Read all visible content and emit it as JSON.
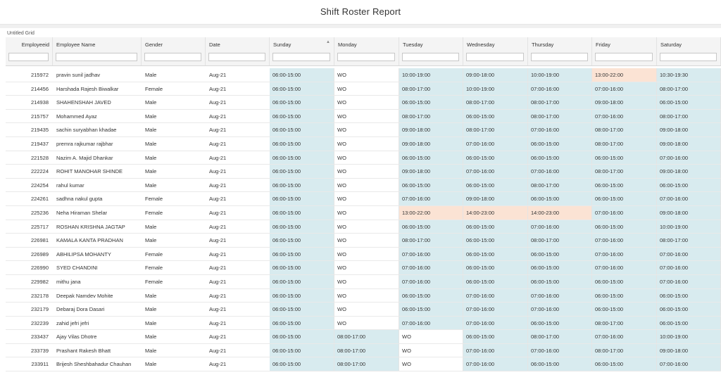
{
  "report_title": "Shift Roster Report",
  "grid_title": "Untitled Grid",
  "columns": [
    "Employeeid",
    "Employee Name",
    "Gender",
    "Date",
    "Sunday",
    "Monday",
    "Tuesday",
    "Wednesday",
    "Thursday",
    "Friday",
    "Saturday"
  ],
  "colors": {
    "blue_cell": "#d8ebef",
    "peach_cell": "#fbe3d4",
    "white_cell": "#ffffff",
    "header_bg": "#f4f4f4"
  },
  "rows": [
    {
      "id": "215972",
      "name": "pravin sunil jadhav",
      "gender": "Male",
      "date": "Aug-21",
      "days": [
        "06:00-15:00",
        "WO",
        "10:00-19:00",
        "09:00-18:00",
        "10:00-19:00",
        "13:00-22:00",
        "10:30-19:30"
      ],
      "tone": [
        "b",
        "w",
        "b",
        "b",
        "b",
        "p",
        "b"
      ]
    },
    {
      "id": "214456",
      "name": "Harshada Rajesh Biwalkar",
      "gender": "Female",
      "date": "Aug-21",
      "days": [
        "06:00-15:00",
        "WO",
        "08:00-17:00",
        "10:00-19:00",
        "07:00-16:00",
        "07:00-16:00",
        "08:00-17:00"
      ],
      "tone": [
        "b",
        "w",
        "b",
        "b",
        "b",
        "b",
        "b"
      ]
    },
    {
      "id": "214938",
      "name": "SHAHENSHAH JAVED",
      "gender": "Male",
      "date": "Aug-21",
      "days": [
        "06:00-15:00",
        "WO",
        "06:00-15:00",
        "08:00-17:00",
        "08:00-17:00",
        "09:00-18:00",
        "06:00-15:00"
      ],
      "tone": [
        "b",
        "w",
        "b",
        "b",
        "b",
        "b",
        "b"
      ]
    },
    {
      "id": "215757",
      "name": "Mohammed Ayaz",
      "gender": "Male",
      "date": "Aug-21",
      "days": [
        "06:00-15:00",
        "WO",
        "08:00-17:00",
        "06:00-15:00",
        "08:00-17:00",
        "07:00-16:00",
        "08:00-17:00"
      ],
      "tone": [
        "b",
        "w",
        "b",
        "b",
        "b",
        "b",
        "b"
      ]
    },
    {
      "id": "219435",
      "name": "sachin suryabhan khadae",
      "gender": "Male",
      "date": "Aug-21",
      "days": [
        "06:00-15:00",
        "WO",
        "09:00-18:00",
        "08:00-17:00",
        "07:00-16:00",
        "08:00-17:00",
        "09:00-18:00"
      ],
      "tone": [
        "b",
        "w",
        "b",
        "b",
        "b",
        "b",
        "b"
      ]
    },
    {
      "id": "219437",
      "name": "premra rajkumar rajbhar",
      "gender": "Male",
      "date": "Aug-21",
      "days": [
        "06:00-15:00",
        "WO",
        "09:00-18:00",
        "07:00-16:00",
        "06:00-15:00",
        "08:00-17:00",
        "09:00-18:00"
      ],
      "tone": [
        "b",
        "w",
        "b",
        "b",
        "b",
        "b",
        "b"
      ]
    },
    {
      "id": "221528",
      "name": "Nazim A. Majid Dhankar",
      "gender": "Male",
      "date": "Aug-21",
      "days": [
        "06:00-15:00",
        "WO",
        "06:00-15:00",
        "06:00-15:00",
        "06:00-15:00",
        "06:00-15:00",
        "07:00-16:00"
      ],
      "tone": [
        "b",
        "w",
        "b",
        "b",
        "b",
        "b",
        "b"
      ]
    },
    {
      "id": "222224",
      "name": "ROHIT MANOHAR SHINDE",
      "gender": "Male",
      "date": "Aug-21",
      "days": [
        "06:00-15:00",
        "WO",
        "09:00-18:00",
        "07:00-16:00",
        "07:00-16:00",
        "08:00-17:00",
        "09:00-18:00"
      ],
      "tone": [
        "b",
        "w",
        "b",
        "b",
        "b",
        "b",
        "b"
      ]
    },
    {
      "id": "224254",
      "name": "rahul kumar",
      "gender": "Male",
      "date": "Aug-21",
      "days": [
        "06:00-15:00",
        "WO",
        "06:00-15:00",
        "06:00-15:00",
        "08:00-17:00",
        "06:00-15:00",
        "06:00-15:00"
      ],
      "tone": [
        "b",
        "w",
        "b",
        "b",
        "b",
        "b",
        "b"
      ]
    },
    {
      "id": "224261",
      "name": "sadhna nakul gupta",
      "gender": "Female",
      "date": "Aug-21",
      "days": [
        "06:00-15:00",
        "WO",
        "07:00-16:00",
        "09:00-18:00",
        "06:00-15:00",
        "06:00-15:00",
        "07:00-16:00"
      ],
      "tone": [
        "b",
        "w",
        "b",
        "b",
        "b",
        "b",
        "b"
      ]
    },
    {
      "id": "225236",
      "name": "Neha Hiraman Shelar",
      "gender": "Female",
      "date": "Aug-21",
      "days": [
        "06:00-15:00",
        "WO",
        "13:00-22:00",
        "14:00-23:00",
        "14:00-23:00",
        "07:00-16:00",
        "09:00-18:00"
      ],
      "tone": [
        "b",
        "w",
        "p",
        "p",
        "p",
        "b",
        "b"
      ]
    },
    {
      "id": "225717",
      "name": "ROSHAN KRISHNA JAGTAP",
      "gender": "Male",
      "date": "Aug-21",
      "days": [
        "06:00-15:00",
        "WO",
        "06:00-15:00",
        "06:00-15:00",
        "07:00-16:00",
        "06:00-15:00",
        "10:00-19:00"
      ],
      "tone": [
        "b",
        "w",
        "b",
        "b",
        "b",
        "b",
        "b"
      ]
    },
    {
      "id": "226981",
      "name": "KAMALA KANTA PRADHAN",
      "gender": "Male",
      "date": "Aug-21",
      "days": [
        "06:00-15:00",
        "WO",
        "08:00-17:00",
        "06:00-15:00",
        "08:00-17:00",
        "07:00-16:00",
        "08:00-17:00"
      ],
      "tone": [
        "b",
        "w",
        "b",
        "b",
        "b",
        "b",
        "b"
      ]
    },
    {
      "id": "226989",
      "name": "ABHILIPSA MOHANTY",
      "gender": "Female",
      "date": "Aug-21",
      "days": [
        "06:00-15:00",
        "WO",
        "07:00-16:00",
        "06:00-15:00",
        "06:00-15:00",
        "07:00-16:00",
        "07:00-16:00"
      ],
      "tone": [
        "b",
        "w",
        "b",
        "b",
        "b",
        "b",
        "b"
      ]
    },
    {
      "id": "226990",
      "name": "SYED CHANDINI",
      "gender": "Female",
      "date": "Aug-21",
      "days": [
        "06:00-15:00",
        "WO",
        "07:00-16:00",
        "06:00-15:00",
        "06:00-15:00",
        "07:00-16:00",
        "07:00-16:00"
      ],
      "tone": [
        "b",
        "w",
        "b",
        "b",
        "b",
        "b",
        "b"
      ]
    },
    {
      "id": "229982",
      "name": "mithu jana",
      "gender": "Female",
      "date": "Aug-21",
      "days": [
        "06:00-15:00",
        "WO",
        "07:00-16:00",
        "06:00-15:00",
        "06:00-15:00",
        "06:00-15:00",
        "07:00-16:00"
      ],
      "tone": [
        "b",
        "w",
        "b",
        "b",
        "b",
        "b",
        "b"
      ]
    },
    {
      "id": "232178",
      "name": "Deepak Namdev Mohite",
      "gender": "Male",
      "date": "Aug-21",
      "days": [
        "06:00-15:00",
        "WO",
        "06:00-15:00",
        "07:00-16:00",
        "07:00-16:00",
        "06:00-15:00",
        "06:00-15:00"
      ],
      "tone": [
        "b",
        "w",
        "b",
        "b",
        "b",
        "b",
        "b"
      ]
    },
    {
      "id": "232179",
      "name": "Debaraj Dora Dasari",
      "gender": "Male",
      "date": "Aug-21",
      "days": [
        "06:00-15:00",
        "WO",
        "06:00-15:00",
        "07:00-16:00",
        "07:00-16:00",
        "06:00-15:00",
        "06:00-15:00"
      ],
      "tone": [
        "b",
        "w",
        "b",
        "b",
        "b",
        "b",
        "b"
      ]
    },
    {
      "id": "232239",
      "name": "zahid jefri jefri",
      "gender": "Male",
      "date": "Aug-21",
      "days": [
        "06:00-15:00",
        "WO",
        "07:00-16:00",
        "07:00-16:00",
        "06:00-15:00",
        "08:00-17:00",
        "06:00-15:00"
      ],
      "tone": [
        "b",
        "w",
        "b",
        "b",
        "b",
        "b",
        "b"
      ]
    },
    {
      "id": "233437",
      "name": "Ajay Vilas Dhotre",
      "gender": "Male",
      "date": "Aug-21",
      "days": [
        "06:00-15:00",
        "08:00-17:00",
        "WO",
        "06:00-15:00",
        "08:00-17:00",
        "07:00-16:00",
        "10:00-19:00"
      ],
      "tone": [
        "b",
        "b",
        "w",
        "b",
        "b",
        "b",
        "b"
      ]
    },
    {
      "id": "233739",
      "name": "Prashant Rakesh Bhatt",
      "gender": "Male",
      "date": "Aug-21",
      "days": [
        "06:00-15:00",
        "08:00-17:00",
        "WO",
        "07:00-16:00",
        "07:00-16:00",
        "08:00-17:00",
        "09:00-18:00"
      ],
      "tone": [
        "b",
        "b",
        "w",
        "b",
        "b",
        "b",
        "b"
      ]
    },
    {
      "id": "233911",
      "name": "Brijesh Sheshbahadur Chauhan",
      "gender": "Male",
      "date": "Aug-21",
      "days": [
        "06:00-15:00",
        "08:00-17:00",
        "WO",
        "07:00-16:00",
        "06:00-15:00",
        "06:00-15:00",
        "07:00-16:00"
      ],
      "tone": [
        "b",
        "b",
        "w",
        "b",
        "b",
        "b",
        "b"
      ]
    }
  ]
}
